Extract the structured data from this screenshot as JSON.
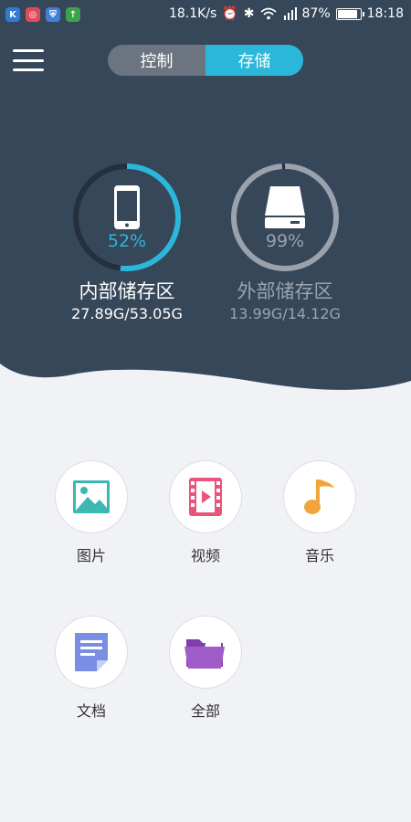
{
  "colors": {
    "header_bg": "#37475a",
    "accent": "#2bb7da",
    "muted": "#9aa3ad",
    "page_bg": "#f1f2f6"
  },
  "status_bar": {
    "speed": "18.1K/s",
    "signal": "4G",
    "battery": "87%",
    "battery_level": 0.87,
    "time": "18:18"
  },
  "segmented": {
    "tabs": [
      {
        "label": "控制",
        "active": false
      },
      {
        "label": "存储",
        "active": true
      }
    ]
  },
  "storage": {
    "internal": {
      "percent_label": "52%",
      "fraction": 0.52,
      "name": "内部储存区",
      "size": "27.89G/53.05G",
      "icon": "phone-icon"
    },
    "external": {
      "percent_label": "99%",
      "fraction": 0.99,
      "name": "外部储存区",
      "size": "13.99G/14.12G",
      "icon": "hard-drive-icon"
    }
  },
  "categories": [
    {
      "label": "图片",
      "icon": "image-icon"
    },
    {
      "label": "视频",
      "icon": "video-icon"
    },
    {
      "label": "音乐",
      "icon": "music-icon"
    },
    {
      "label": "文档",
      "icon": "document-icon"
    },
    {
      "label": "全部",
      "icon": "folder-icon"
    }
  ]
}
